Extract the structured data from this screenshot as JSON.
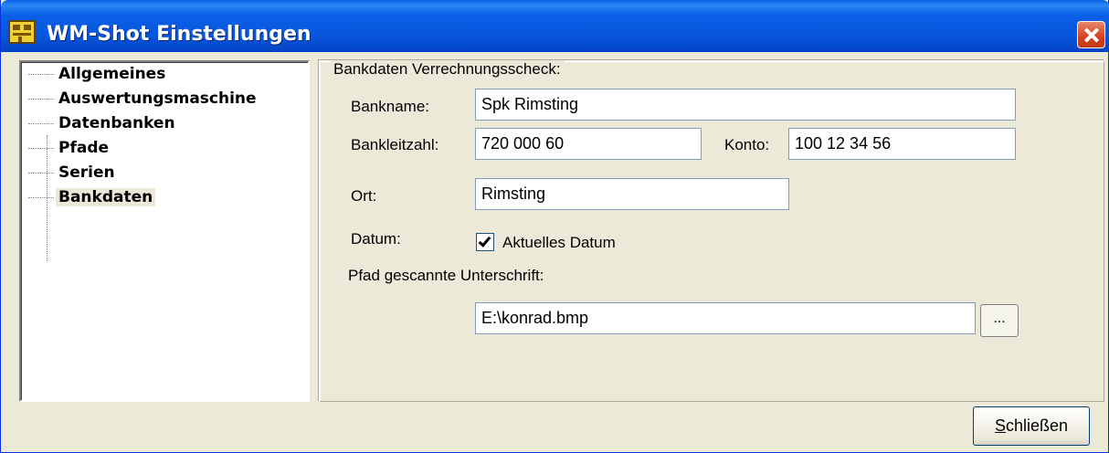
{
  "window": {
    "title": "WM-Shot Einstellungen"
  },
  "tree": {
    "items": [
      {
        "label": "Allgemeines"
      },
      {
        "label": "Auswertungsmaschine"
      },
      {
        "label": "Datenbanken"
      },
      {
        "label": "Pfade"
      },
      {
        "label": "Serien"
      },
      {
        "label": "Bankdaten",
        "selected": true
      }
    ]
  },
  "bank": {
    "group_label": "Bankdaten Verrechnungsscheck:",
    "bankname_label": "Bankname:",
    "bankname_value": "Spk Rimsting",
    "blz_label": "Bankleitzahl:",
    "blz_value": "720 000 60",
    "konto_label": "Konto:",
    "konto_value": "100 12 34 56",
    "ort_label": "Ort:",
    "ort_value": "Rimsting",
    "datum_label": "Datum:",
    "datum_checkbox_label": "Aktuelles Datum",
    "datum_checked": true,
    "pfad_label": "Pfad gescannte Unterschrift:",
    "pfad_value": "E:\\konrad.bmp",
    "browse_label": "..."
  },
  "footer": {
    "close_first": "S",
    "close_rest": "chließen"
  },
  "colors": {
    "titlebar": "#0a5fe6",
    "dialog_bg": "#ece9d8",
    "close": "#d4431c"
  }
}
